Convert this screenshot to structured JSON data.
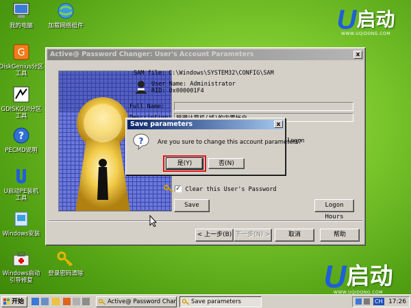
{
  "desktop": {
    "icons": [
      {
        "label": "我的电脑"
      },
      {
        "label": "加载网络组件"
      },
      {
        "label": "DiskGenius分区\n工具"
      },
      {
        "label": "GDISKGUI分区\n工具"
      },
      {
        "label": "PECMD说明"
      },
      {
        "label": "U启动PE装机\n工具"
      },
      {
        "label": "Windows安装"
      },
      {
        "label": "Windows启动\n引导修复"
      },
      {
        "label": "登录密码清除"
      }
    ],
    "brand": {
      "u": "U",
      "name": "启动",
      "url": "WWW.UQIDONG.COM"
    }
  },
  "window": {
    "title": "Active@ Password Changer: User's Account Parameters",
    "close": "x",
    "sam_file": "SAM file: C:\\Windows\\SYSTEM32\\CONFIG\\SAM",
    "user_name": "User Name: Administrator",
    "rid": "RID: 0x000001F4",
    "full_name_label": "Full Name:",
    "description_label": "Description:",
    "description_value": "管理计算机(域)的内置帐户",
    "logon_label": "logon",
    "clear_password_label": "Clear this User's Password",
    "save_button": "Save",
    "logon_hours_button": "Logon Hours",
    "back_button": "< 上一步(B)",
    "next_button": "下一步(N) >",
    "cancel_button": "取消",
    "help_button": "帮助"
  },
  "dialog": {
    "title": "Save parameters",
    "close": "x",
    "message": "Are you sure to change this account parameters?",
    "yes_button": "是(Y)",
    "no_button": "否(N)"
  },
  "taskbar": {
    "start_label": "开始",
    "tasks": [
      {
        "label": "Active@ Password Chan..."
      },
      {
        "label": "Save parameters"
      }
    ],
    "lang": "CH",
    "clock": "17:26"
  }
}
